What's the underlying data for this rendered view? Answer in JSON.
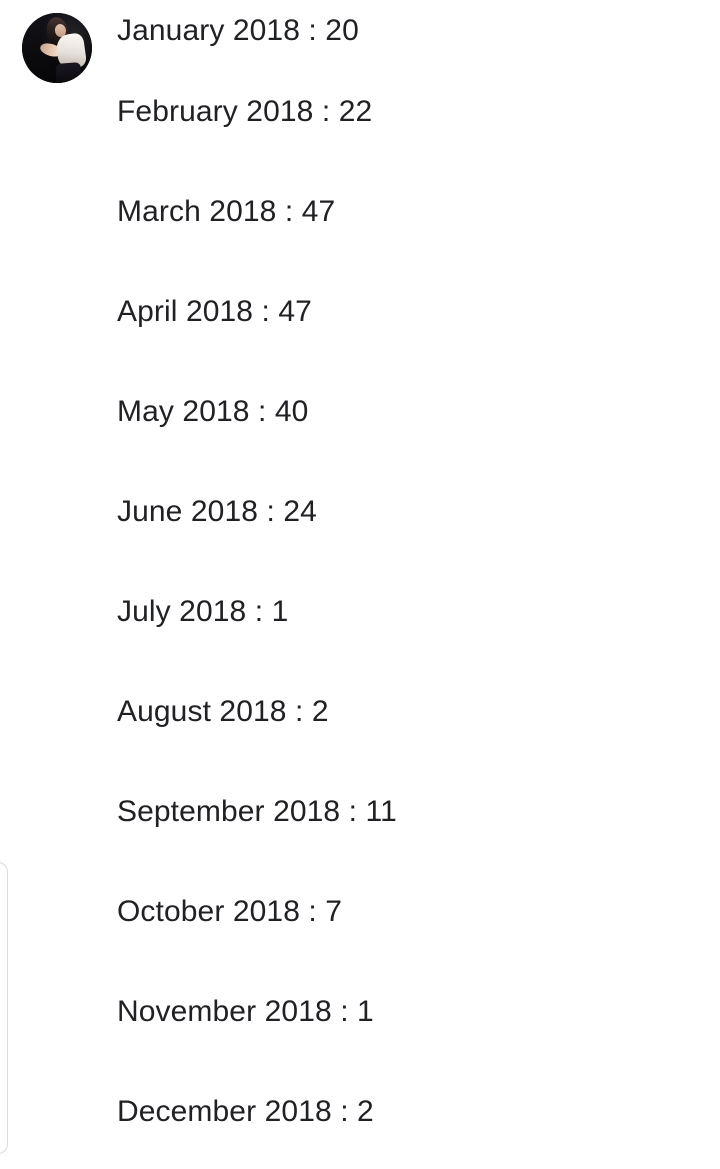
{
  "background_color": "#ffffff",
  "text_color": "#202124",
  "card_border_color": "#dadce0",
  "avatar": {
    "name": "profile-photo",
    "description": "circular profile photo, dark background with person in white top"
  },
  "stats": {
    "separator": " : ",
    "rows": [
      {
        "label": "January 2018",
        "value": "20",
        "text": "January 2018 : 20"
      },
      {
        "label": "February 2018",
        "value": "22",
        "text": "February 2018 : 22"
      },
      {
        "label": "March 2018",
        "value": "47",
        "text": "March 2018 : 47"
      },
      {
        "label": "April 2018",
        "value": "47",
        "text": "April 2018 : 47"
      },
      {
        "label": "May 2018",
        "value": "40",
        "text": "May 2018 : 40"
      },
      {
        "label": "June 2018",
        "value": "24",
        "text": "June 2018 : 24"
      },
      {
        "label": "July 2018",
        "value": "1",
        "text": "July 2018 : 1"
      },
      {
        "label": "August 2018",
        "value": "2",
        "text": "August 2018 : 2"
      },
      {
        "label": "September 2018",
        "value": "11",
        "text": "September 2018 : 11"
      },
      {
        "label": "October 2018",
        "value": "7",
        "text": "October 2018 : 7"
      },
      {
        "label": "November 2018",
        "value": "1",
        "text": "November 2018 : 1"
      },
      {
        "label": "December 2018",
        "value": "2",
        "text": "December 2018 : 2"
      }
    ]
  }
}
